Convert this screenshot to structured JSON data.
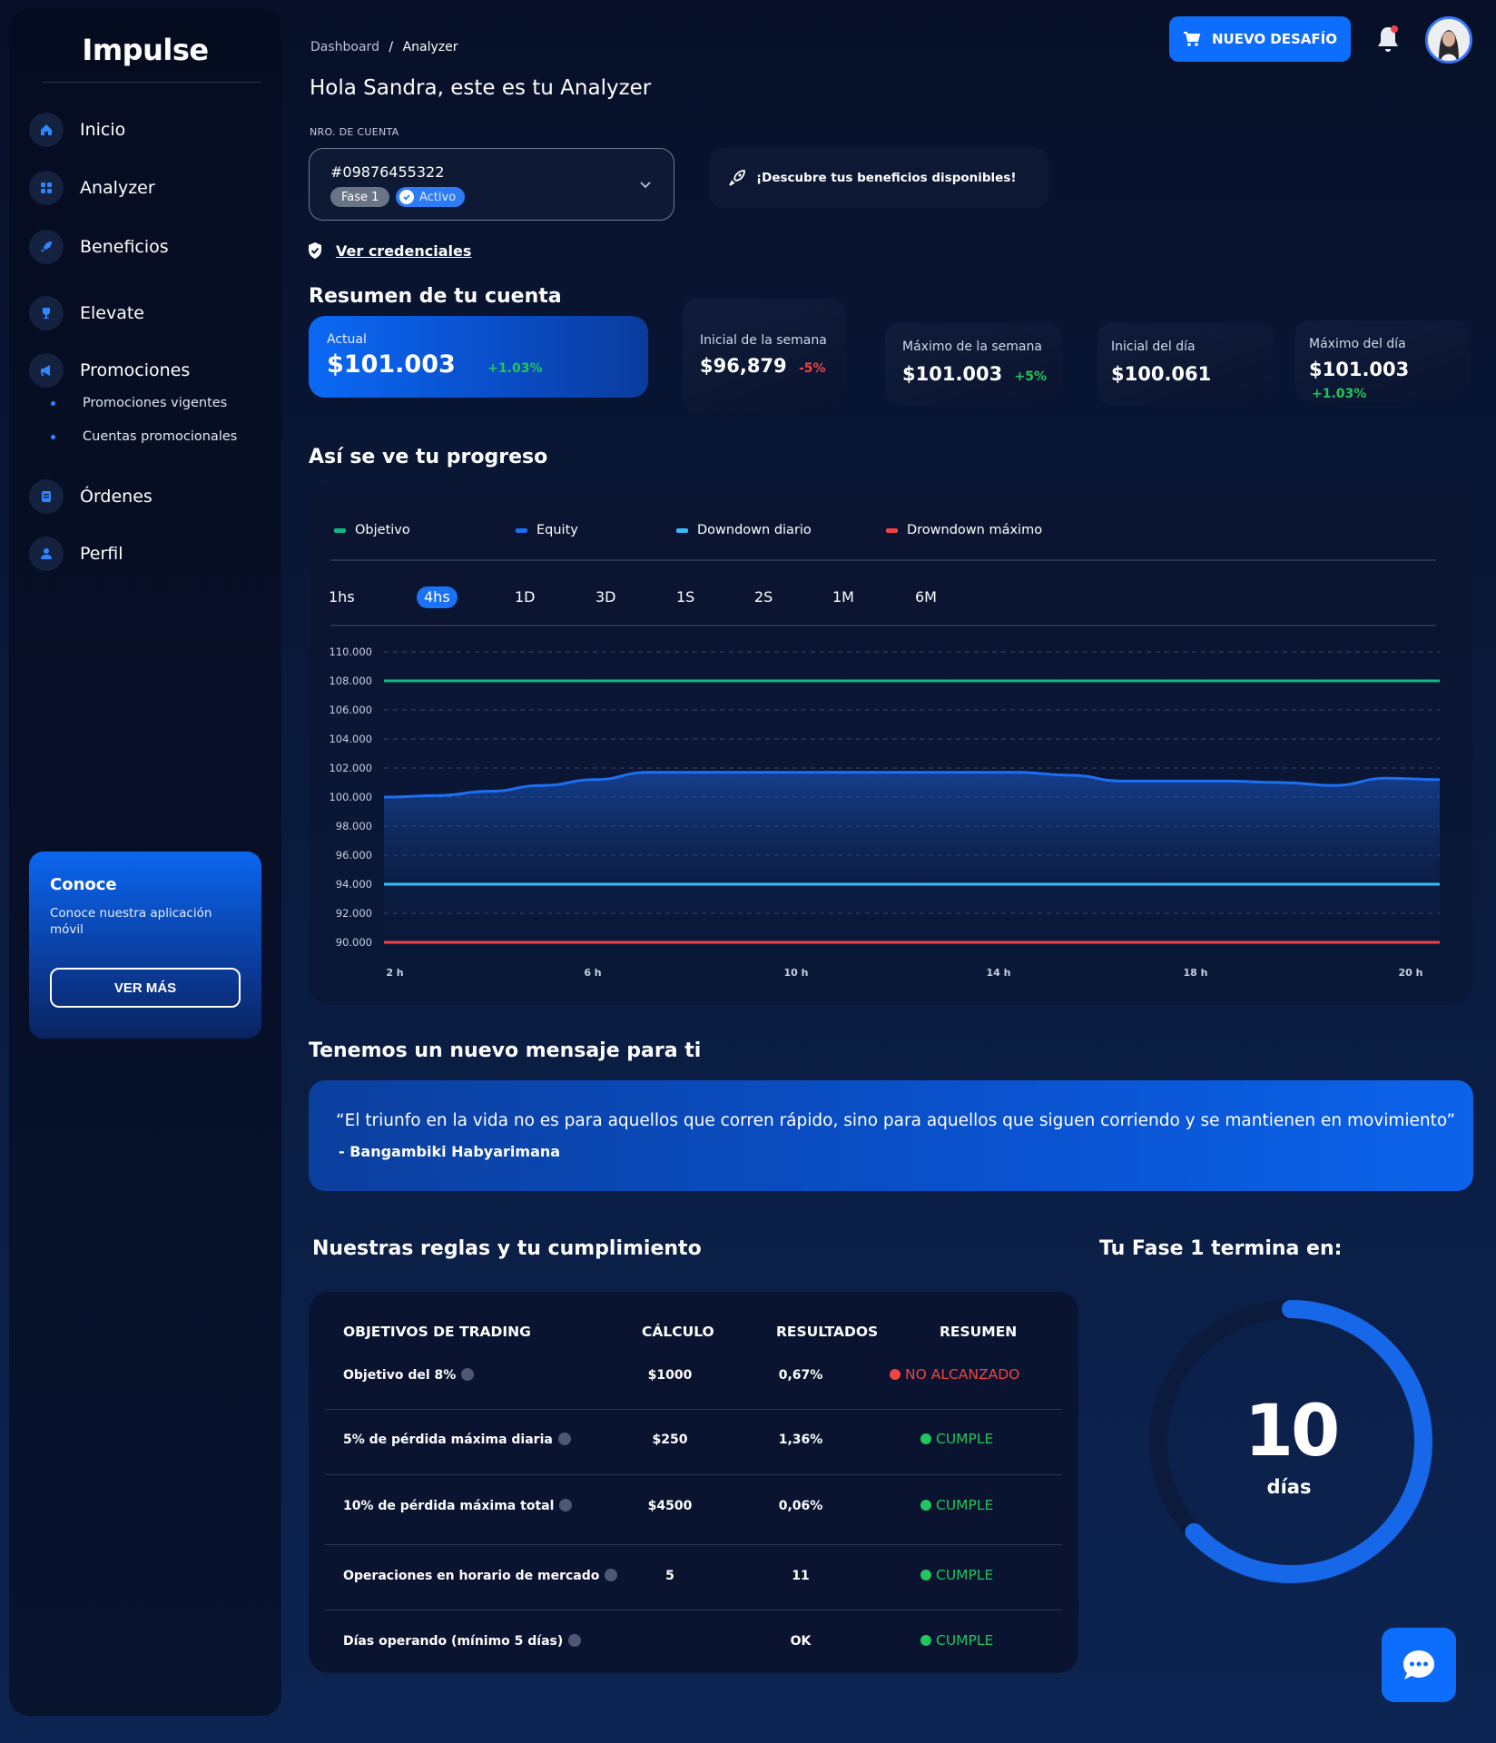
{
  "app": {
    "logo": "Impulse"
  },
  "sidebar": {
    "items": [
      {
        "label": "Inicio",
        "icon": "home-icon"
      },
      {
        "label": "Analyzer",
        "icon": "grid-icon"
      },
      {
        "label": "Beneficios",
        "icon": "rocket-icon"
      },
      {
        "label": "Elevate",
        "icon": "trophy-icon"
      },
      {
        "label": "Promociones",
        "icon": "megaphone-icon"
      },
      {
        "label": "Órdenes",
        "icon": "clipboard-icon"
      },
      {
        "label": "Perfil",
        "icon": "user-icon"
      }
    ],
    "subitems": [
      "Promociones vigentes",
      "Cuentas promocionales"
    ],
    "promo": {
      "title": "Conoce",
      "text": "Conoce nuestra aplicación móvil",
      "button": "VER MÁS"
    }
  },
  "header": {
    "breadcrumb_root": "Dashboard",
    "breadcrumb_sep": "/",
    "breadcrumb_current": "Analyzer",
    "greeting": "Hola Sandra, este es tu Analyzer",
    "new_challenge": "NUEVO DESAFÍO"
  },
  "account": {
    "label": "NRO. DE CUENTA",
    "number": "#09876455322",
    "phase": "Fase 1",
    "status": "Activo",
    "benefits": "¡Descubre tus beneficios disponibles!",
    "credentials": "Ver credenciales"
  },
  "summary": {
    "title": "Resumen de tu cuenta",
    "cards": [
      {
        "label": "Actual",
        "value": "$101.003",
        "pct": "+1.03%"
      },
      {
        "label": "Inicial de la semana",
        "value": "$96,879",
        "pct": "-5%"
      },
      {
        "label": "Máximo de la semana",
        "value": "$101.003",
        "pct": "+5%"
      },
      {
        "label": "Inicial del día",
        "value": "$100.061",
        "pct": ""
      },
      {
        "label": "Máximo del día",
        "value": "$101.003",
        "pct": "+1.03%"
      }
    ]
  },
  "progress": {
    "title": "Así se ve tu progreso",
    "timeframes": [
      "1hs",
      "4hs",
      "1D",
      "3D",
      "1S",
      "2S",
      "1M",
      "6M"
    ],
    "active_timeframe": "4hs"
  },
  "chart_data": {
    "type": "line",
    "series": [
      {
        "name": "Objetivo",
        "color": "#10b981",
        "x": [
          "1h",
          "21h"
        ],
        "values": [
          108000,
          108000
        ]
      },
      {
        "name": "Equity",
        "color": "#1d6ff2",
        "x": [
          "1h",
          "2h",
          "3h",
          "4h",
          "5h",
          "6h",
          "7h",
          "8h",
          "9h",
          "10h",
          "11h",
          "12h",
          "13h",
          "14h",
          "15h",
          "16h",
          "17h",
          "18h",
          "19h",
          "20h",
          "21h"
        ],
        "values": [
          100000,
          100100,
          100400,
          100800,
          101200,
          101700,
          101700,
          101700,
          101700,
          101700,
          101700,
          101700,
          101700,
          101500,
          101100,
          101100,
          101100,
          101000,
          100800,
          101300,
          101200
        ]
      },
      {
        "name": "Downdown diario",
        "color": "#38bdf8",
        "x": [
          "1h",
          "21h"
        ],
        "values": [
          94000,
          94000
        ]
      },
      {
        "name": "Drowndown máximo",
        "color": "#ef4444",
        "x": [
          "1h",
          "21h"
        ],
        "values": [
          90000,
          90000
        ]
      }
    ],
    "y_ticks": [
      "110.000",
      "108.000",
      "106.000",
      "104.000",
      "102.000",
      "100.000",
      "98.000",
      "96.000",
      "94.000",
      "92.000",
      "90.000"
    ],
    "x_ticks": [
      "2 h",
      "6 h",
      "10 h",
      "14 h",
      "18 h",
      "20 h"
    ],
    "ylim": [
      90000,
      110000
    ],
    "grid": true,
    "legend": "top-left"
  },
  "message": {
    "title": "Tenemos un nuevo mensaje para ti",
    "quote": "“El triunfo en la vida no es para aquellos que corren rápido, sino para aquellos que siguen corriendo y se mantienen en movimiento”",
    "author": "- Bangambiki Habyarimana"
  },
  "rules": {
    "title": "Nuestras reglas y tu cumplimiento",
    "headers": [
      "OBJETIVOS DE TRADING",
      "CÁLCULO",
      "RESULTADOS",
      "RESUMEN"
    ],
    "rows": [
      {
        "objective": "Objetivo del 8%",
        "calc": "$1000",
        "result": "0,67%",
        "summary": "NO ALCANZADO",
        "ok": false
      },
      {
        "objective": "5% de pérdida máxima diaria",
        "calc": "$250",
        "result": "1,36%",
        "summary": "CUMPLE",
        "ok": true
      },
      {
        "objective": "10% de pérdida máxima total",
        "calc": "$4500",
        "result": "0,06%",
        "summary": "CUMPLE",
        "ok": true
      },
      {
        "objective": "Operaciones en horario de mercado",
        "calc": "5",
        "result": "11",
        "summary": "CUMPLE",
        "ok": true
      },
      {
        "objective": "Días operando (mínimo 5 días)",
        "calc": "",
        "result": "OK",
        "summary": "CUMPLE",
        "ok": true
      }
    ]
  },
  "phase_end": {
    "title": "Tu Fase 1 termina en:",
    "value": "10",
    "unit": "días",
    "progress": 0.63
  },
  "colors": {
    "primary": "#0d6efd",
    "positive": "#22c55e",
    "negative": "#ef4444"
  }
}
